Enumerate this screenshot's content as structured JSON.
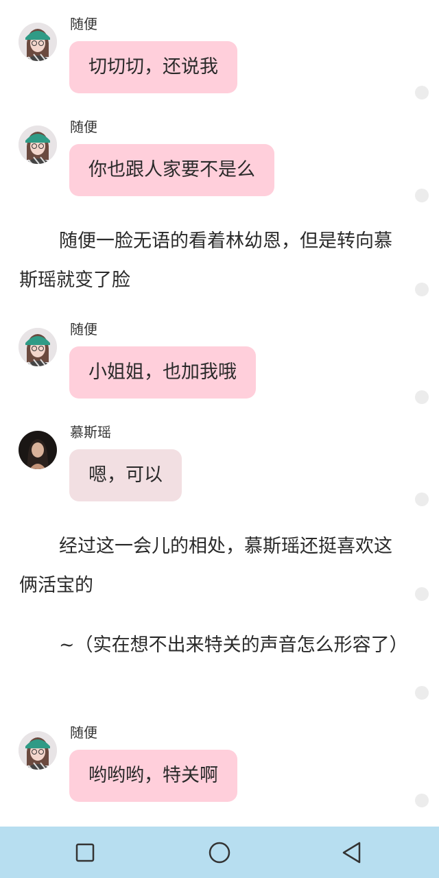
{
  "messages": [
    {
      "sender": "随便",
      "text": "切切切，还说我",
      "avatar": "girl-cap-avatar"
    },
    {
      "sender": "随便",
      "text": "你也跟人家要不是么",
      "avatar": "girl-cap-avatar"
    },
    {
      "sender": "随便",
      "text": "小姐姐，也加我哦",
      "avatar": "girl-cap-avatar"
    },
    {
      "sender": "慕斯瑶",
      "text": "嗯，可以",
      "avatar": "girl-dark-avatar"
    },
    {
      "sender": "随便",
      "text": "哟哟哟，特关啊",
      "avatar": "girl-cap-avatar"
    }
  ],
  "narration": [
    "随便一脸无语的看着林幼恩，但是转向慕斯瑶就变了脸",
    "经过这一会儿的相处，慕斯瑶还挺喜欢这俩活宝的",
    "~（实在想不出来特关的声音怎么形容了）"
  ],
  "colors": {
    "bubble_pink": "#ffcfdb",
    "bubble_alt": "#f2dfe2",
    "navbar": "#b7def0"
  },
  "navbar": {
    "icons": [
      "recent-apps-icon",
      "home-icon",
      "back-icon"
    ]
  }
}
